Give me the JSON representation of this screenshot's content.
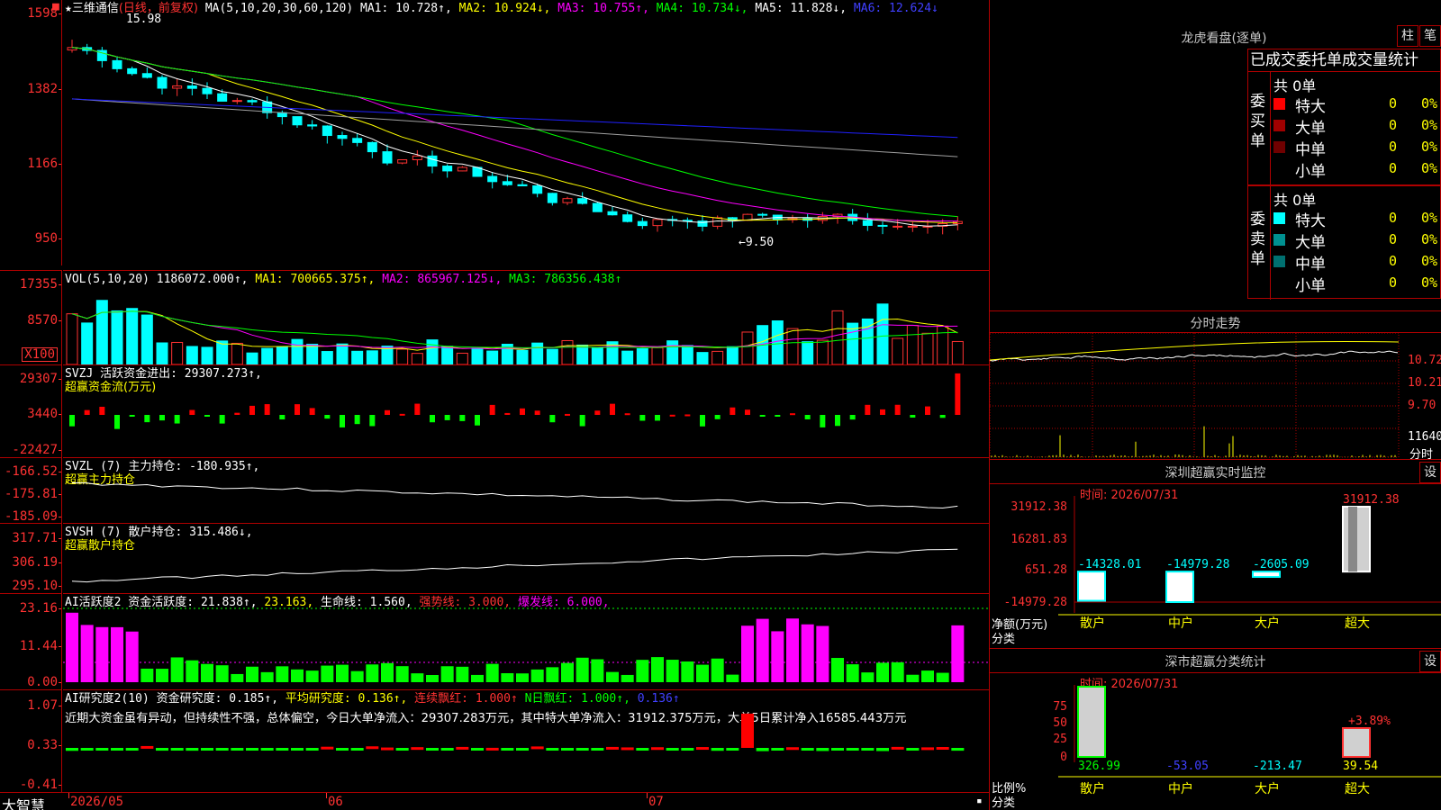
{
  "header": {
    "star": "★",
    "stock_name": "三维通信",
    "period": "(日线，前复权)",
    "ma_label": "MA(5,10,20,30,60,120)",
    "ma1": "MA1: 10.728↑,",
    "ma2": "MA2: 10.924↓,",
    "ma3": "MA3: 10.755↑,",
    "ma4": "MA4: 10.734↓,",
    "ma5": "MA5: 11.828↓,",
    "ma6": "MA6: 12.624↓"
  },
  "price_axis": [
    "1598",
    "1382",
    "1166",
    "950"
  ],
  "price_high_label": "15.98",
  "price_low_label": "←9.50",
  "vol": {
    "label": "VOL(5,10,20)",
    "val": "1186072.000↑,",
    "ma1": "MA1: 700665.375↑,",
    "ma2": "MA2: 865967.125↓,",
    "ma3": "MA3: 786356.438↑",
    "axis": [
      "17355",
      "8570"
    ],
    "unit": "X100"
  },
  "svzj": {
    "label": "SVZJ  活跃资金进出: 29307.273↑,",
    "label2": "超赢资金流(万元)",
    "axis": [
      "29307",
      "3440",
      "-22427"
    ]
  },
  "svzl": {
    "label": "SVZL (7) 主力持仓: -180.935↑,",
    "label2": "超赢主力持仓",
    "axis": [
      "-166.52",
      "-175.81",
      "-185.09"
    ]
  },
  "svsh": {
    "label": "SVSH (7) 散户持仓: 315.486↓,",
    "label2": "超赢散户持仓",
    "axis": [
      "317.71",
      "306.19",
      "295.10"
    ]
  },
  "ai_act": {
    "a": "AI活跃度2 资金活跃度: 21.838↑,",
    "b": "23.163,",
    "c": "生命线: 1.560,",
    "d": "强势线: 3.000,",
    "e": "爆发线: 6.000,",
    "axis": [
      "23.16",
      "11.44",
      "0.00"
    ]
  },
  "ai_res": {
    "a": "AI研究度2(10) 资金研究度: 0.185↑,",
    "b": "平均研究度: 0.136↑,",
    "c": "连续飘红: 1.000↑",
    "d": "N日飘红: 1.000↑,",
    "e": "0.136↑",
    "comment": "近期大资金虽有异动，但持续性不强，总体偏空，今日大单净流入：29307.283万元，其中特大单净流入：31912.375万元，大单5日累计净入16585.443万元",
    "axis": [
      "1.07",
      "0.33",
      "-0.41"
    ]
  },
  "date_axis": [
    "2026/05",
    "06",
    "07"
  ],
  "brand": "大智慧",
  "right": {
    "lhb_title": "龙虎看盘(逐单)",
    "btn_zhu": "柱",
    "btn_bi": "笔",
    "tab_title": "已成交委托单成交量统计",
    "buy_side": "委买单",
    "sell_side": "委卖单",
    "buy_total": "共 0单",
    "sell_total": "共 0单",
    "buy_rows": [
      {
        "name": "特大",
        "count": "0",
        "pct": "0%",
        "color": "#ff0000"
      },
      {
        "name": "大单",
        "count": "0",
        "pct": "0%",
        "color": "#a00000"
      },
      {
        "name": "中单",
        "count": "0",
        "pct": "0%",
        "color": "#700000"
      },
      {
        "name": "小单",
        "count": "0",
        "pct": "0%",
        "color": "#000000"
      }
    ],
    "sell_rows": [
      {
        "name": "特大",
        "count": "0",
        "pct": "0%",
        "color": "#00ffff"
      },
      {
        "name": "大单",
        "count": "0",
        "pct": "0%",
        "color": "#009090"
      },
      {
        "name": "中单",
        "count": "0",
        "pct": "0%",
        "color": "#007070"
      },
      {
        "name": "小单",
        "count": "0",
        "pct": "0%",
        "color": "#000000"
      }
    ],
    "fs_title": "分时走势",
    "fs_axis": [
      "10.72",
      "10.21",
      "9.70",
      "11640"
    ],
    "fs_unit": "分时",
    "sz_title": "深圳超赢实时监控",
    "sz_btn": "设",
    "sz_time": "时间: 2026/07/31",
    "sz_axis": [
      "31912.38",
      "16281.83",
      "651.28",
      "-14979.28"
    ],
    "sz_bars": [
      {
        "label": "散户",
        "value": "-14328.01"
      },
      {
        "label": "中户",
        "value": "-14979.28"
      },
      {
        "label": "大户",
        "value": "-2605.09"
      },
      {
        "label": "超大",
        "value": "31912.38"
      }
    ],
    "sz_ylabel": "净额(万元)",
    "sz_xlabel": "分类",
    "cls_title": "深市超赢分类统计",
    "cls_btn": "设",
    "cls_time": "时间: 2026/07/31",
    "cls_axis": [
      "75",
      "50",
      "25",
      "0"
    ],
    "cls_bars": [
      {
        "label": "散户",
        "value": "326.99"
      },
      {
        "label": "中户",
        "value": "-53.05"
      },
      {
        "label": "大户",
        "value": "-213.47"
      },
      {
        "label": "超大",
        "value": "39.54"
      }
    ],
    "cls_pct": "+3.89%",
    "cls_ylabel": "比例%",
    "cls_xlabel": "分类"
  },
  "chart_data": {
    "type": "bar",
    "categories": [
      "散户",
      "中户",
      "大户",
      "超大"
    ],
    "values": [
      -14328.01,
      -14979.28,
      -2605.09,
      31912.38
    ],
    "title": "深圳超赢实时监控",
    "xlabel": "分类",
    "ylabel": "净额(万元)",
    "ylim": [
      -14979.28,
      31912.38
    ]
  }
}
